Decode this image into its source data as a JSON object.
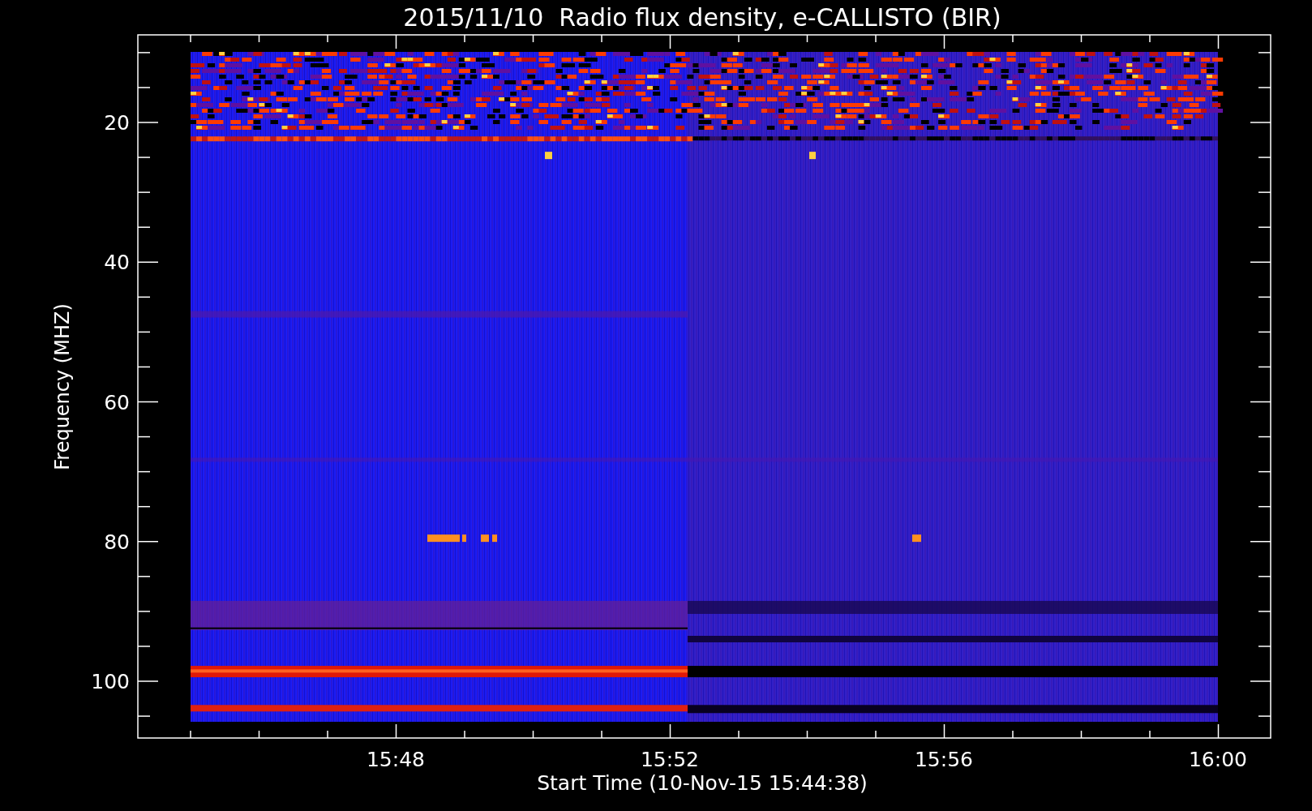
{
  "plot": {
    "title": "2015/11/10  Radio flux density, e-CALLISTO (BIR)",
    "ylabel": "Frequency (MHZ)",
    "xlabel": "Start Time (10-Nov-15 15:44:38)",
    "y_tick_labels": [
      "20",
      "40",
      "60",
      "80",
      "100"
    ],
    "x_tick_labels": [
      "15:48",
      "15:52",
      "15:56",
      "16:00"
    ]
  }
}
